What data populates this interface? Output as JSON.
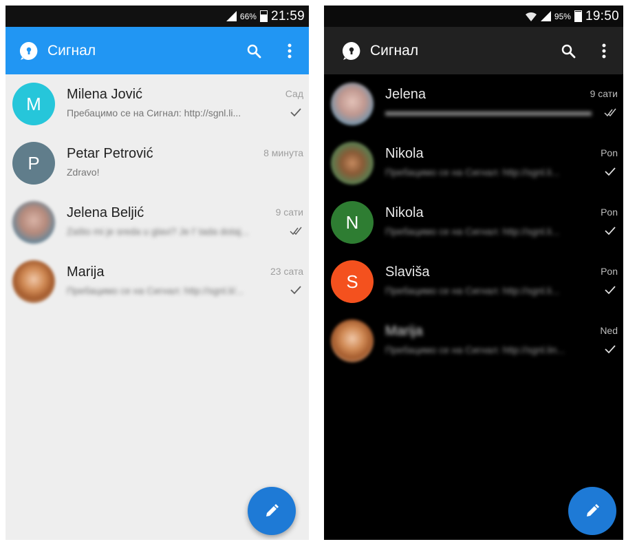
{
  "colors": {
    "light_toolbar": "#2196f3",
    "dark_toolbar": "#212121",
    "fab": "#1e7ad6",
    "avatar_teal": "#26c6da",
    "avatar_slate": "#607d8b",
    "avatar_green": "#2e7d32",
    "avatar_orange": "#f4511e"
  },
  "light": {
    "status": {
      "battery": "66%",
      "time": "21:59",
      "battery_level": 0.66
    },
    "toolbar": {
      "title": "Сигнал",
      "logo_icon": "signal-logo-icon",
      "search_icon": "search-icon",
      "overflow_icon": "overflow-menu-icon"
    },
    "conversations": [
      {
        "name": "Milena Jović",
        "time": "Сад",
        "snippet": "Пребацимо се на Сигнал: http://sgnl.li...",
        "initial": "M",
        "status": "sent"
      },
      {
        "name": "Petar Petrović",
        "time": "8 минута",
        "snippet": "Zdravo!",
        "initial": "P",
        "status": "none"
      },
      {
        "name": "Jelena Beljić",
        "time": "9 сати",
        "snippet": "Zašto mi je sreda u glavi? Je l' tada dotaj...",
        "initial": "",
        "status": "delivered"
      },
      {
        "name": "Marija",
        "time": "23 сата",
        "snippet": "Пребацимо се на Сигнал: http://sgnl.li/...",
        "initial": "",
        "status": "sent"
      }
    ],
    "fab_icon": "pencil-icon"
  },
  "dark": {
    "status": {
      "battery": "95%",
      "time": "19:50",
      "battery_level": 0.95
    },
    "toolbar": {
      "title": "Сигнал",
      "logo_icon": "signal-logo-icon",
      "search_icon": "search-icon",
      "overflow_icon": "overflow-menu-icon"
    },
    "conversations": [
      {
        "name": "Jelena",
        "time": "9 сати",
        "snippet": "",
        "initial": "",
        "status": "delivered"
      },
      {
        "name": "Nikola",
        "time": "Pon",
        "snippet": "Пребацимо се на Сигнал: http://sgnl.li...",
        "initial": "",
        "status": "sent"
      },
      {
        "name": "Nikola",
        "time": "Pon",
        "snippet": "Пребацимо се на Сигнал: http://sgnl.li...",
        "initial": "N",
        "status": "sent"
      },
      {
        "name": "Slaviša",
        "time": "Pon",
        "snippet": "Пребацимо се на Сигнал: http://sgnl.li...",
        "initial": "S",
        "status": "sent"
      },
      {
        "name": "Marija",
        "time": "Ned",
        "snippet": "Пребацимо се на Сигнал: http://sgnl.lin...",
        "initial": "",
        "status": "sent"
      }
    ],
    "fab_icon": "pencil-icon"
  }
}
